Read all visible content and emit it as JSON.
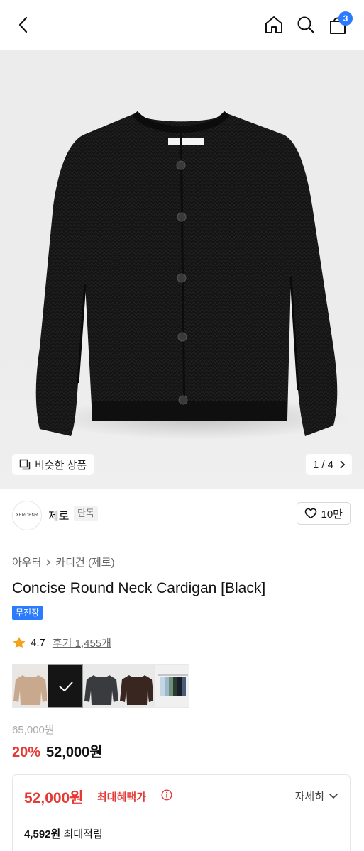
{
  "header": {
    "cart_count": "3"
  },
  "hero": {
    "similar_label": "비슷한 상품",
    "counter": "1 / 4"
  },
  "brand": {
    "logo_text": "XEROBNR",
    "name": "제로",
    "tag": "단독",
    "likes": "10만"
  },
  "category": {
    "level1": "아우터",
    "level2": "카디건 (제로)"
  },
  "product": {
    "title": "Concise Round Neck Cardigan [Black]",
    "shipping_badge": "무진장",
    "rating": "4.7",
    "reviews": "후기 1,455개",
    "original_price": "65,000원",
    "discount": "20%",
    "price": "52,000원"
  },
  "swatches": [
    {
      "name": "beige",
      "color": "#c8a98e"
    },
    {
      "name": "black",
      "color": "#151515",
      "selected": true
    },
    {
      "name": "charcoal",
      "color": "#3a3b3e"
    },
    {
      "name": "brown",
      "color": "#3a2621"
    },
    {
      "name": "all-colors",
      "color": "#f0f0f0"
    }
  ],
  "benefit": {
    "price": "52,000원",
    "label": "최대혜택가",
    "detail": "자세히",
    "points_amount": "4,592원",
    "points_label": "최대적립"
  },
  "colors": {
    "accent_red": "#e53935",
    "accent_blue": "#2b7bff"
  }
}
